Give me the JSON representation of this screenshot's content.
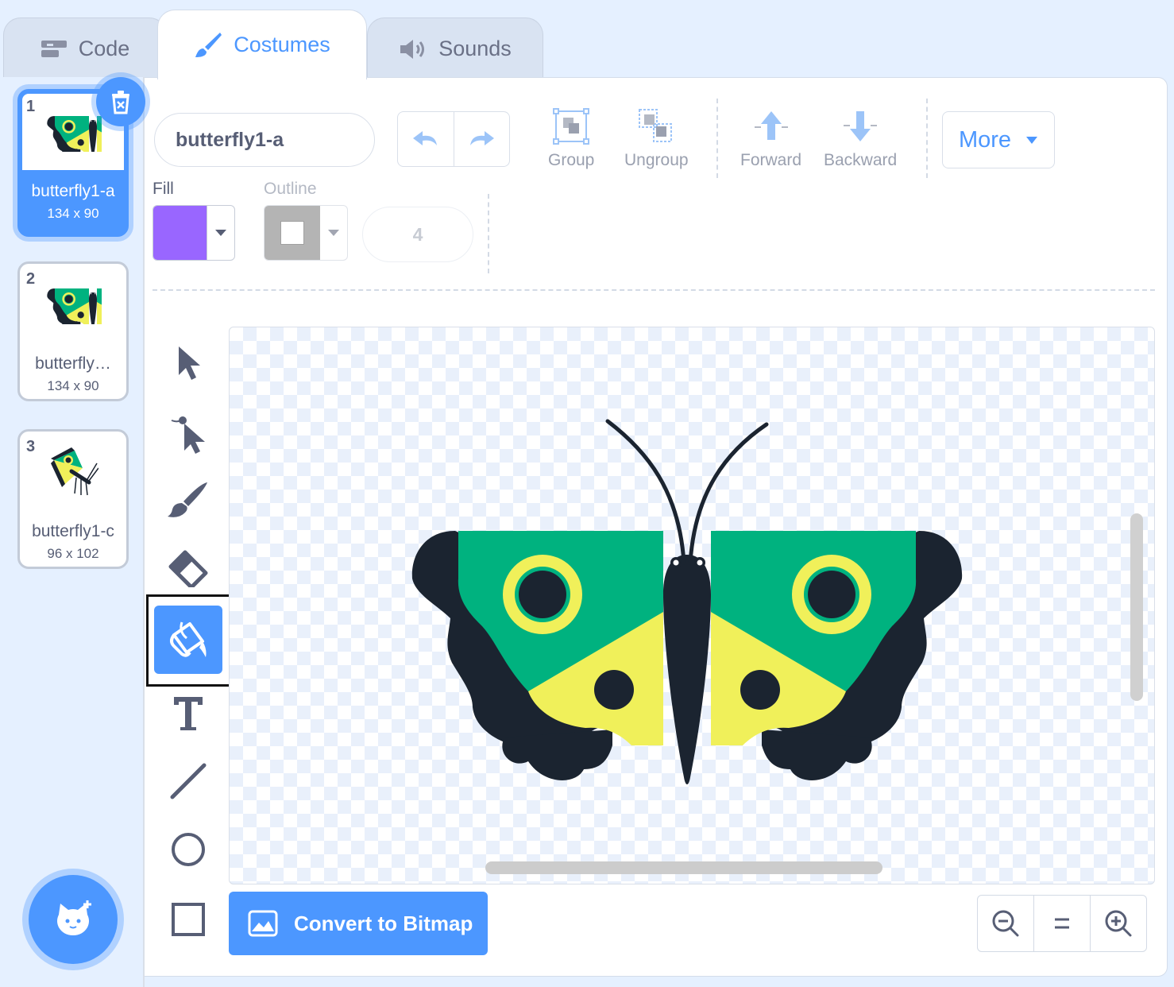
{
  "tabs": [
    {
      "label": "Code",
      "icon": "code-blocks-icon"
    },
    {
      "label": "Costumes",
      "icon": "paintbrush-icon",
      "active": true
    },
    {
      "label": "Sounds",
      "icon": "speaker-icon"
    }
  ],
  "costumes": [
    {
      "number": "1",
      "name": "butterfly1-a",
      "size": "134 x 90",
      "selected": true
    },
    {
      "number": "2",
      "name": "butterfly…",
      "size": "134 x 90"
    },
    {
      "number": "3",
      "name": "butterfly1-c",
      "size": "96 x 102"
    }
  ],
  "editor": {
    "costume_name": "butterfly1-a",
    "group_label": "Group",
    "ungroup_label": "Ungroup",
    "forward_label": "Forward",
    "backward_label": "Backward",
    "more_label": "More",
    "fill_label": "Fill",
    "outline_label": "Outline",
    "fill_color": "#9966ff",
    "stroke_width": "4",
    "convert_label": "Convert to Bitmap"
  },
  "tools": [
    "select-tool",
    "reshape-tool",
    "brush-tool",
    "eraser-tool",
    "fill-tool",
    "text-tool",
    "line-tool",
    "circle-tool",
    "rectangle-tool"
  ],
  "active_tool": "fill-tool",
  "colors": {
    "accent": "#4c97ff",
    "wing_green": "#00b27f",
    "wing_yellow": "#f0f05a",
    "wing_dark": "#1b2430"
  }
}
